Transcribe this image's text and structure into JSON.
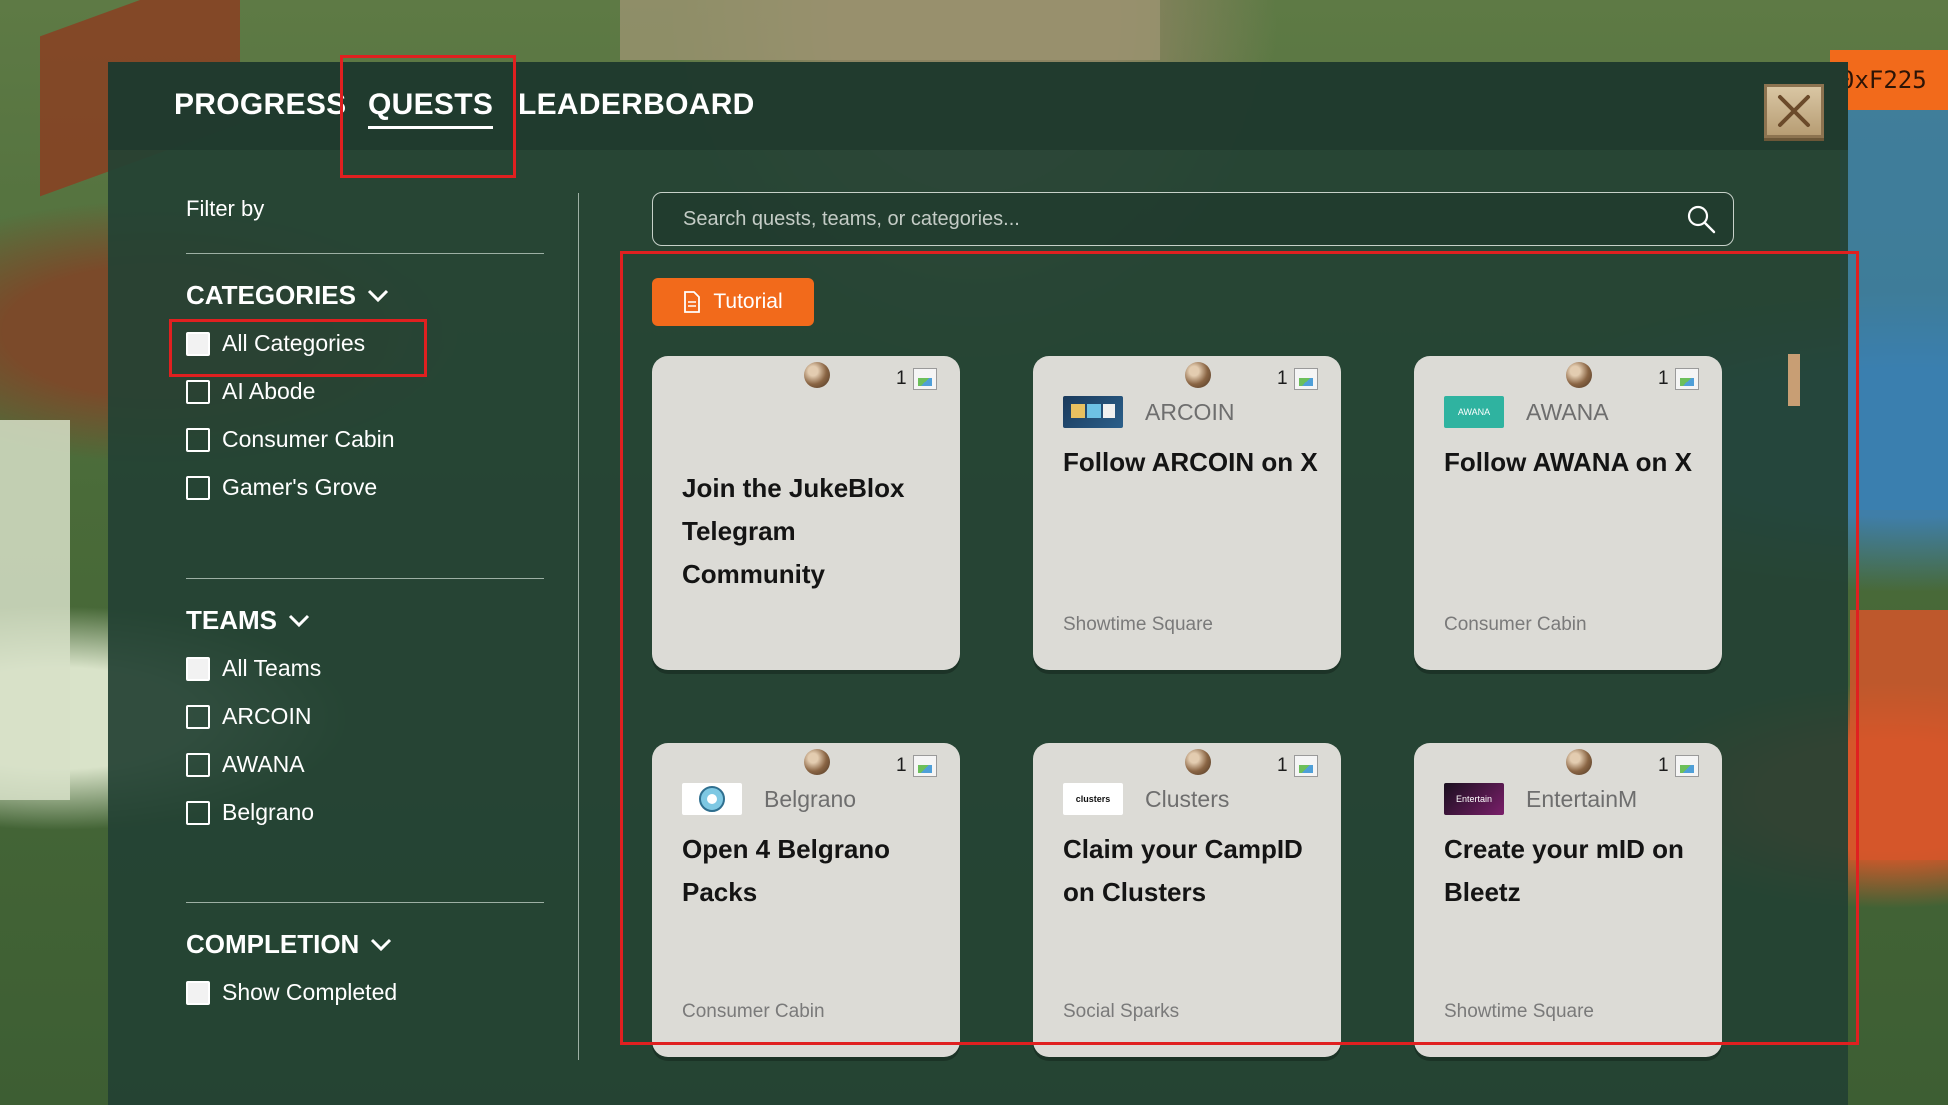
{
  "corner_tag": "0xF225",
  "tabs": [
    {
      "label": "PROGRESS"
    },
    {
      "label": "QUESTS"
    },
    {
      "label": "LEADERBOARD"
    }
  ],
  "sidebar": {
    "filter_label": "Filter by",
    "categories": {
      "heading": "CATEGORIES",
      "items": [
        "All Categories",
        "AI Abode",
        "Consumer Cabin",
        "Gamer's Grove"
      ]
    },
    "teams": {
      "heading": "TEAMS",
      "items": [
        "All Teams",
        "ARCOIN",
        "AWANA",
        "Belgrano"
      ]
    },
    "completion": {
      "heading": "COMPLETION",
      "items": [
        "Show Completed"
      ]
    }
  },
  "search": {
    "placeholder": "Search quests, teams, or categories..."
  },
  "tutorial_label": "Tutorial",
  "quests": [
    {
      "reward": "1",
      "team": "",
      "title": "Join the JukeBlox Telegram Community",
      "category": ""
    },
    {
      "reward": "1",
      "team": "ARCOIN",
      "title": "Follow ARCOIN on X",
      "category": "Showtime Square"
    },
    {
      "reward": "1",
      "team": "AWANA",
      "title": "Follow AWANA on X",
      "category": "Consumer Cabin"
    },
    {
      "reward": "1",
      "team": "Belgrano",
      "title": "Open 4 Belgrano Packs",
      "category": "Consumer Cabin"
    },
    {
      "reward": "1",
      "team": "Clusters",
      "title": "Claim your CampID on Clusters",
      "category": "Social Sparks"
    },
    {
      "reward": "1",
      "team": "EntertainM",
      "title": "Create your mID on Bleetz",
      "category": "Showtime Square"
    }
  ],
  "logo_text": {
    "awana": "AWANA",
    "clusters": "clusters",
    "entertainm": "Entertain"
  },
  "colors": {
    "accent": "#f26a1b",
    "panel": "#244234",
    "card": "#dcdbd6",
    "highlight": "#e02020"
  }
}
